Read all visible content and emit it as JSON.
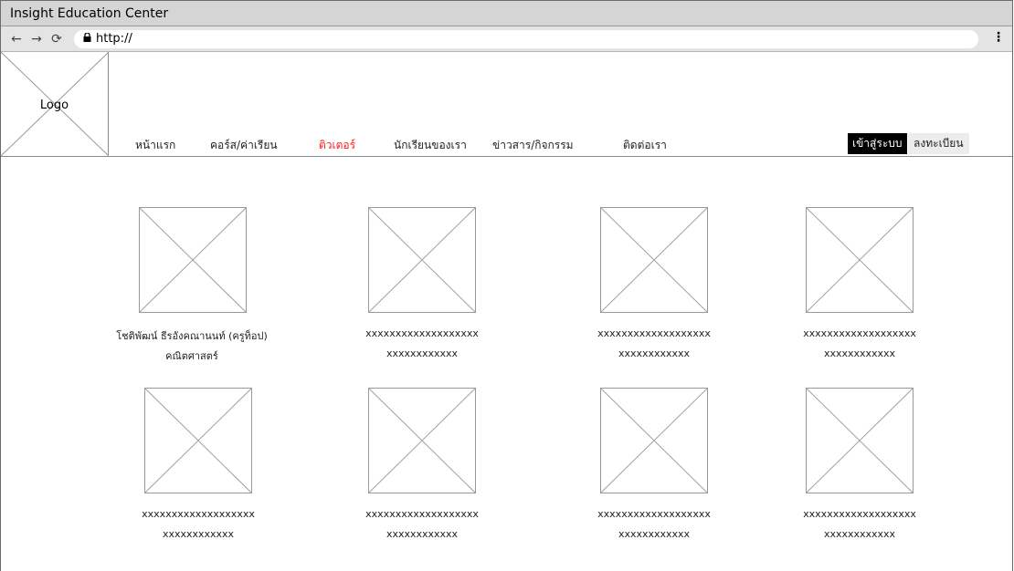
{
  "window": {
    "title": "Insight Education Center"
  },
  "browser": {
    "back_icon": "←",
    "forward_icon": "→",
    "reload_icon": "⟳",
    "url": "http://",
    "menu_icon": "⋮"
  },
  "header": {
    "logo_text": "Logo",
    "nav": [
      {
        "label": "หน้าแรก",
        "active": false
      },
      {
        "label": "คอร์ส/ค่าเรียน",
        "active": false
      },
      {
        "label": "ติวเตอร์",
        "active": true
      },
      {
        "label": "นักเรียนของเรา",
        "active": false
      },
      {
        "label": "ข่าวสาร/กิจกรรม",
        "active": false
      },
      {
        "label": "ติดต่อเรา",
        "active": false
      }
    ],
    "login_label": "เข้าสู่ระบบ",
    "register_label": "ลงทะเบียน"
  },
  "tutors": [
    {
      "name": "โชติพัฒน์ ธีรอังคณานนท์ (ครูท็อป)",
      "subject": "คณิตศาสตร์"
    },
    {
      "name": "xxxxxxxxxxxxxxxxxxx",
      "subject": "xxxxxxxxxxxx"
    },
    {
      "name": "xxxxxxxxxxxxxxxxxxx",
      "subject": "xxxxxxxxxxxx"
    },
    {
      "name": "xxxxxxxxxxxxxxxxxxx",
      "subject": "xxxxxxxxxxxx"
    },
    {
      "name": "xxxxxxxxxxxxxxxxxxx",
      "subject": "xxxxxxxxxxxx"
    },
    {
      "name": "xxxxxxxxxxxxxxxxxxx",
      "subject": "xxxxxxxxxxxx"
    },
    {
      "name": "xxxxxxxxxxxxxxxxxxx",
      "subject": "xxxxxxxxxxxx"
    },
    {
      "name": "xxxxxxxxxxxxxxxxxxx",
      "subject": "xxxxxxxxxxxx"
    }
  ]
}
